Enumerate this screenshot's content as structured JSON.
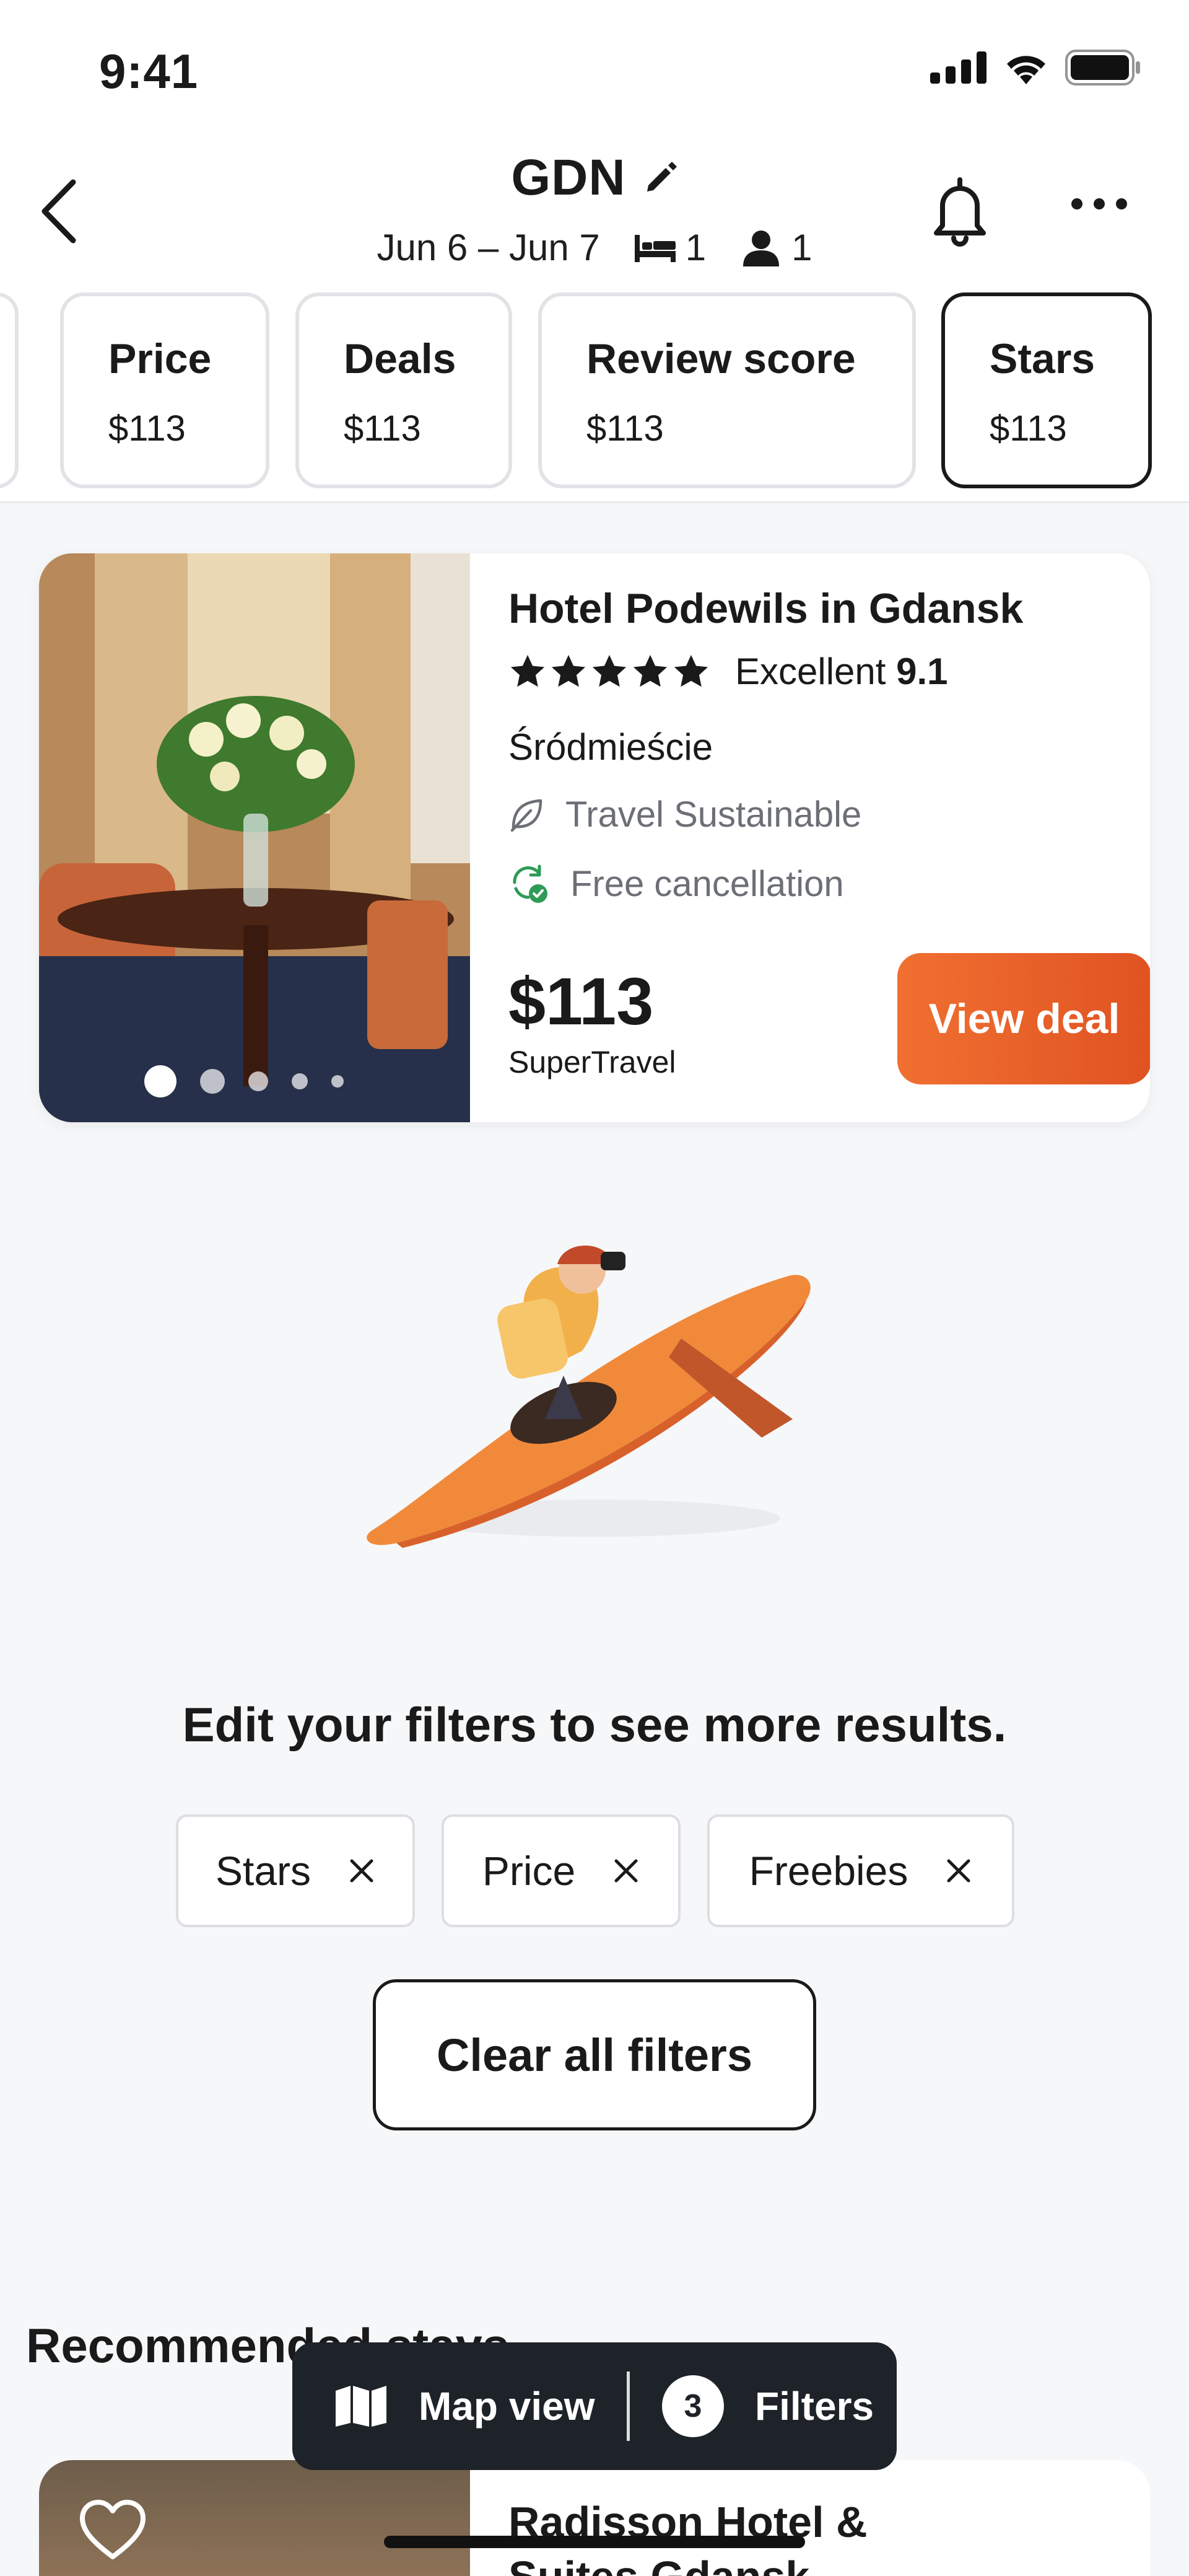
{
  "status_bar": {
    "time": "9:41"
  },
  "header": {
    "title": "GDN",
    "dates": "Jun 6 – Jun 7",
    "rooms": "1",
    "guests": "1"
  },
  "sort_chips": [
    {
      "label": "Price",
      "price": "$113",
      "active": false
    },
    {
      "label": "Deals",
      "price": "$113",
      "active": false
    },
    {
      "label": "Review score",
      "price": "$113",
      "active": false
    },
    {
      "label": "Stars",
      "price": "$113",
      "active": true
    }
  ],
  "hotel": {
    "name": "Hotel Podewils in Gdansk",
    "stars": 5,
    "rating_word": "Excellent",
    "rating_score": "9.1",
    "district": "Śródmieście",
    "features": [
      "Travel Sustainable",
      "Free cancellation"
    ],
    "price": "$113",
    "provider": "SuperTravel",
    "cta": "View deal",
    "photo_index": 1,
    "photo_count": 5
  },
  "empty_state": {
    "title": "Edit your filters to see more results.",
    "filters": [
      "Stars",
      "Price",
      "Freebies"
    ],
    "clear_label": "Clear all filters"
  },
  "recommended": {
    "title": "Recommended stays",
    "hotel_name": "Radisson Hotel & Suites Gdansk"
  },
  "floating_bar": {
    "map_label": "Map view",
    "filters_label": "Filters",
    "filters_count": "3"
  },
  "colors": {
    "accent": "#e8592a",
    "sustainable_icon": "#6c6f75",
    "free_cancel_icon": "#2e9b57"
  }
}
